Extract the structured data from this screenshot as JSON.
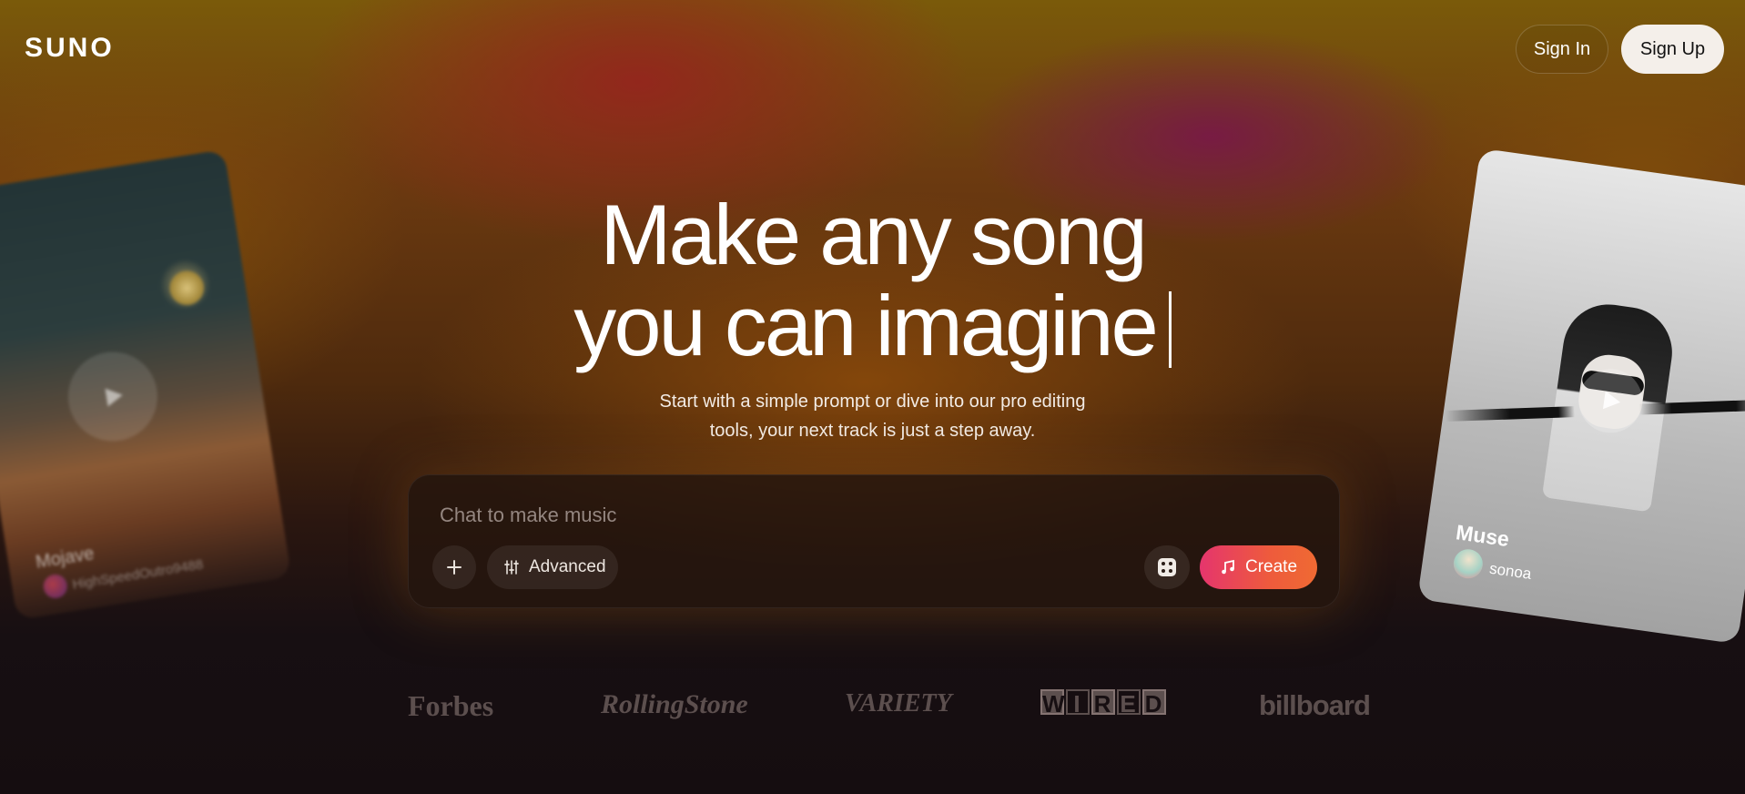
{
  "header": {
    "logo": "SUNO",
    "sign_in": "Sign In",
    "sign_up": "Sign Up"
  },
  "hero": {
    "headline_line1": "Make any song",
    "headline_line2": "you can imagine",
    "subtitle_line1": "Start with a simple prompt or dive into our pro editing",
    "subtitle_line2": "tools, your next track is just a step away."
  },
  "composer": {
    "placeholder": "Chat to make music",
    "add_icon": "plus-icon",
    "advanced_label": "Advanced",
    "advanced_icon": "sliders-icon",
    "dice_icon": "dice-icon",
    "create_label": "Create",
    "create_icon": "music-note-icon"
  },
  "cards": [
    {
      "title": "Mojave",
      "user": "HighSpeedOutro9488",
      "play_icon": "play-icon"
    },
    {
      "title": "Muse",
      "user": "sonoa",
      "play_icon": "play-icon"
    }
  ],
  "press": {
    "logos": [
      "Forbes",
      "RollingStone",
      "VARIETY",
      "WIRED",
      "billboard"
    ]
  },
  "colors": {
    "create_gradient_start": "#e5356d",
    "create_gradient_end": "#ef6a33",
    "sign_up_bg": "#f4efea"
  }
}
